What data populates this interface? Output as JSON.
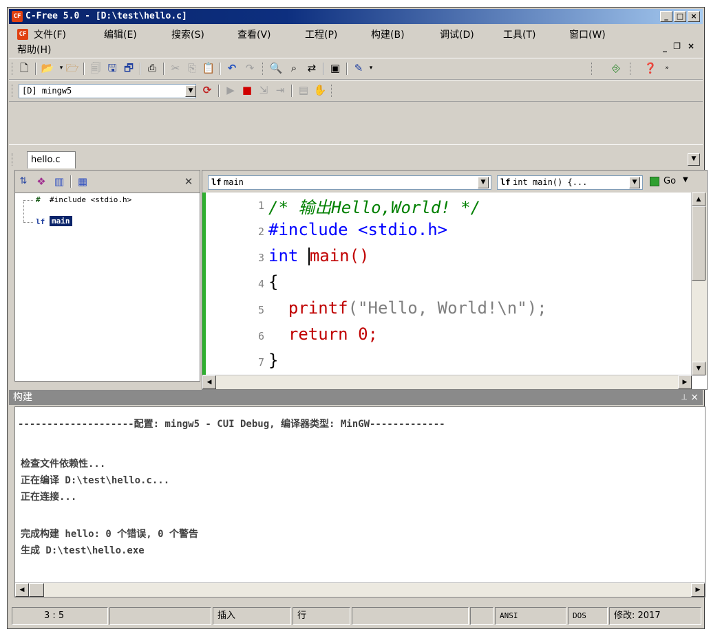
{
  "window": {
    "title": "C-Free 5.0 - [D:\\test\\hello.c]",
    "app_icon_label": "CF"
  },
  "menu": {
    "items": [
      "文件(F)",
      "编辑(E)",
      "搜索(S)",
      "查看(V)",
      "工程(P)",
      "构建(B)",
      "调试(D)",
      "工具(T)",
      "窗口(W)",
      "帮助(H)"
    ]
  },
  "toolbar2": {
    "config_value": "[D] mingw5"
  },
  "tabs": {
    "file_tab": "hello.c"
  },
  "classview": {
    "tree": [
      "#include <stdio.h>",
      "main"
    ]
  },
  "editor": {
    "scope_combo": "main",
    "func_combo": "int main() {...",
    "go_label": "Go",
    "lines": [
      {
        "num": "1",
        "text": "/* 输出Hello,World! */"
      },
      {
        "num": "2",
        "text": "#include <stdio.h>"
      },
      {
        "num": "3",
        "kw": "int",
        "fn": "main()"
      },
      {
        "num": "4",
        "text": "{"
      },
      {
        "num": "5",
        "fn": "printf",
        "str": "(\"Hello, World!\\n\");"
      },
      {
        "num": "6",
        "fn": "return",
        "str": "0;"
      },
      {
        "num": "7",
        "text": "}"
      }
    ]
  },
  "build": {
    "title": "构建",
    "lines": [
      "--------------------配置: mingw5 - CUI Debug, 编译器类型: MinGW-------------",
      "",
      "检查文件依赖性...",
      "正在编译 D:\\test\\hello.c...",
      "正在连接...",
      "",
      "完成构建 hello: 0 个错误, 0 个警告",
      "生成 D:\\test\\hello.exe"
    ]
  },
  "status": {
    "position": "3 :  5",
    "insert": "插入",
    "row": "行",
    "encoding": "ANSI",
    "line_ending": "DOS",
    "modified": "修改: 2017"
  }
}
